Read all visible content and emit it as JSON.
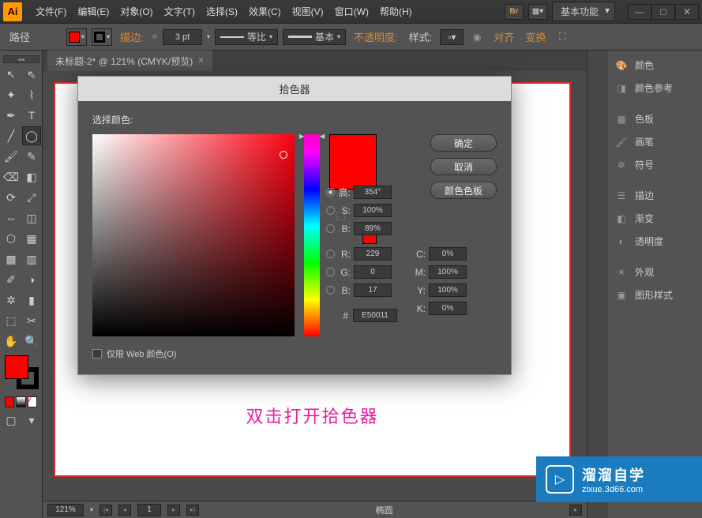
{
  "app_abbr": "Ai",
  "menu": [
    "文件(F)",
    "编辑(E)",
    "对象(O)",
    "文字(T)",
    "选择(S)",
    "效果(C)",
    "视图(V)",
    "窗口(W)",
    "帮助(H)"
  ],
  "workspace": "基本功能",
  "options": {
    "tool_label": "路径",
    "stroke_label": "描边:",
    "stroke_pt": "3 pt",
    "profile_label": "等比",
    "brush_label": "基本",
    "opacity_label": "不透明度:",
    "style_label": "样式:",
    "align_label": "对齐",
    "transform_label": "变换"
  },
  "doc_tab": "未标题-2* @ 121% (CMYK/预览)",
  "artboard_text": "双击打开拾色器",
  "status": {
    "zoom": "121%",
    "page": "1",
    "shape": "椭圆"
  },
  "panels": [
    "颜色",
    "颜色参考",
    "色板",
    "画笔",
    "符号",
    "描边",
    "渐变",
    "透明度",
    "外观",
    "图形样式"
  ],
  "dialog": {
    "title": "拾色器",
    "pick_label": "选择颜色:",
    "ok": "确定",
    "cancel": "取消",
    "swatches": "颜色色板",
    "hsb": {
      "h_label": "高:",
      "h": "354°",
      "s_label": "S:",
      "s": "100%",
      "b_label": "B:",
      "b": "89%"
    },
    "rgb": {
      "r_label": "R:",
      "r": "229",
      "g_label": "G:",
      "g": "0",
      "b_label": "B:",
      "b": "17"
    },
    "cmyk": {
      "c_label": "C:",
      "c": "0%",
      "m_label": "M:",
      "m": "100%",
      "y_label": "Y:",
      "y": "100%",
      "k_label": "K:",
      "k": "0%"
    },
    "hex_label": "#",
    "hex": "E50011",
    "webonly": "仅限 Web 颜色(O)"
  },
  "watermark": {
    "brand": "溜溜自学",
    "url": "zixue.3d66.com"
  }
}
